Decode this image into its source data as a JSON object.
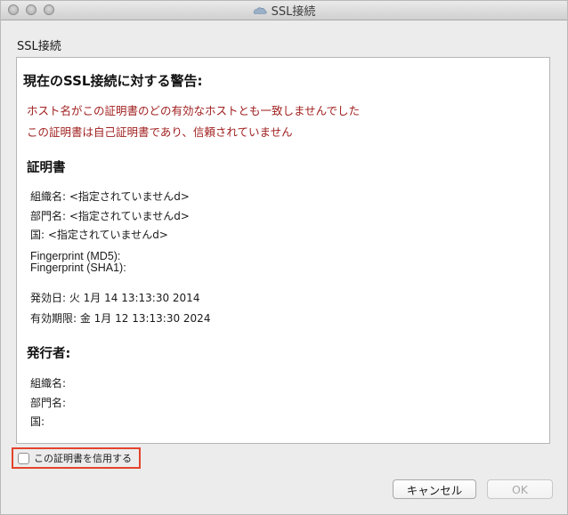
{
  "window": {
    "title": "SSL接続"
  },
  "heading": "SSL接続",
  "warnings": {
    "title": "現在のSSL接続に対する警告:",
    "lines": [
      "ホスト名がこの証明書のどの有効なホストとも一致しませんでした",
      "この証明書は自己証明書であり、信頼されていません"
    ]
  },
  "certificate": {
    "title": "証明書",
    "organization": "組織名: <指定されていませんd>",
    "department": "部門名: <指定されていませんd>",
    "country": "国: <指定されていませんd>",
    "fingerprint_md5": "Fingerprint (MD5):",
    "fingerprint_sha1": "Fingerprint (SHA1):",
    "issued": "発効日: 火 1月 14 13:13:30 2014",
    "expiry": "有効期限: 金 1月 12 13:13:30 2024"
  },
  "issuer": {
    "title": "発行者:",
    "organization": "組織名:",
    "department": "部門名:",
    "country": "国:"
  },
  "trust_checkbox": {
    "label": "この証明書を信用する",
    "checked": false
  },
  "buttons": {
    "cancel": "キャンセル",
    "ok": "OK"
  },
  "colors": {
    "warning_text": "#a12020",
    "highlight_border": "#e4432c"
  }
}
